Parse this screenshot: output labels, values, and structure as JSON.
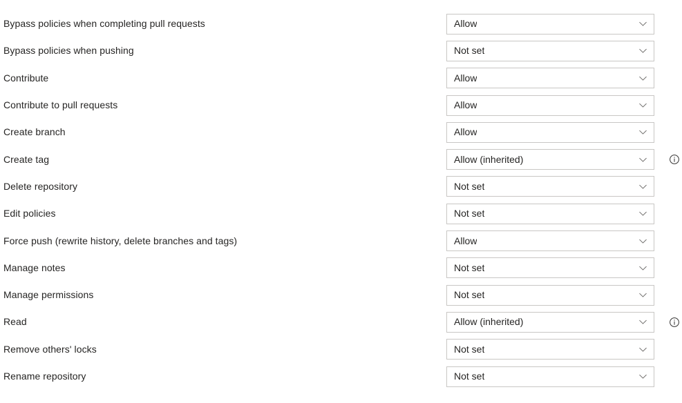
{
  "icons": {
    "chevron": "chevron-down-icon",
    "info": "info-circle-icon"
  },
  "colors": {
    "text": "#252423",
    "border": "#c8c6c4",
    "background": "#ffffff",
    "chevron": "#605e5c"
  },
  "permissions": {
    "rows": [
      {
        "label": "Bypass policies when completing pull requests",
        "value": "Allow",
        "has_info": false
      },
      {
        "label": "Bypass policies when pushing",
        "value": "Not set",
        "has_info": false
      },
      {
        "label": "Contribute",
        "value": "Allow",
        "has_info": false
      },
      {
        "label": "Contribute to pull requests",
        "value": "Allow",
        "has_info": false
      },
      {
        "label": "Create branch",
        "value": "Allow",
        "has_info": false
      },
      {
        "label": "Create tag",
        "value": "Allow (inherited)",
        "has_info": true
      },
      {
        "label": "Delete repository",
        "value": "Not set",
        "has_info": false
      },
      {
        "label": "Edit policies",
        "value": "Not set",
        "has_info": false
      },
      {
        "label": "Force push (rewrite history, delete branches and tags)",
        "value": "Allow",
        "has_info": false
      },
      {
        "label": "Manage notes",
        "value": "Not set",
        "has_info": false
      },
      {
        "label": "Manage permissions",
        "value": "Not set",
        "has_info": false
      },
      {
        "label": "Read",
        "value": "Allow (inherited)",
        "has_info": true
      },
      {
        "label": "Remove others' locks",
        "value": "Not set",
        "has_info": false
      },
      {
        "label": "Rename repository",
        "value": "Not set",
        "has_info": false
      }
    ]
  }
}
